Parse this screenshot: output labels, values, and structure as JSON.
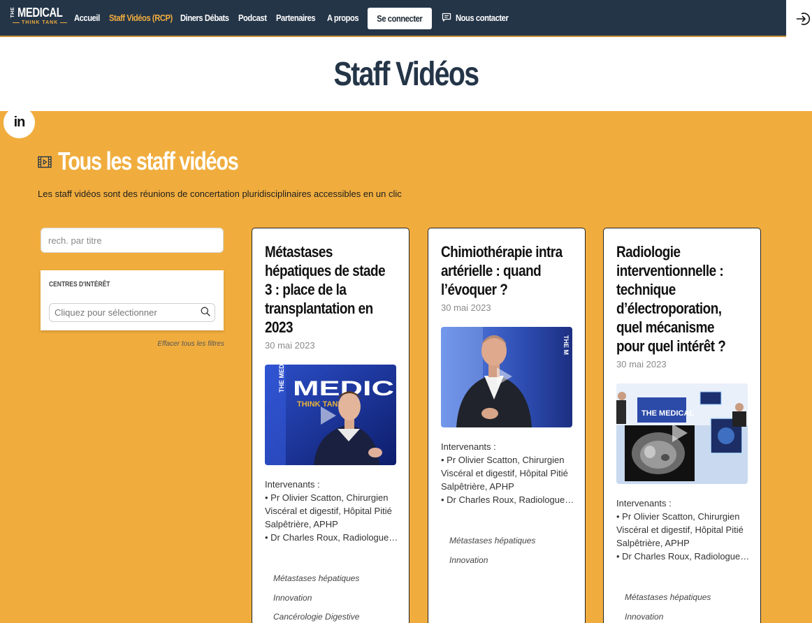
{
  "nav": {
    "logo": {
      "the": "THE",
      "medical": "MEDICAL",
      "think_tank": "THINK TANK"
    },
    "items": [
      {
        "label": "Accueil",
        "active": false
      },
      {
        "label": "Staff Vidéos (RCP)",
        "active": true
      },
      {
        "label": "Diners Débats",
        "active": false
      },
      {
        "label": "Podcast",
        "active": false
      },
      {
        "label": "Partenaires",
        "active": false
      },
      {
        "label": "A propos",
        "active": false
      }
    ],
    "connect_label": "Se connecter",
    "contact_label": "Nous contacter"
  },
  "page_title": "Staff Vidéos",
  "linkedin_label": "in",
  "section": {
    "title": "Tous les staff vidéos",
    "description": "Les staff vidéos sont des réunions de concertation pluridisciplinaires accessibles en un clic"
  },
  "filters": {
    "search_placeholder": "rech. par titre",
    "interests_label": "CENTRES D'INTÉRÊT",
    "interests_placeholder": "Cliquez pour sélectionner",
    "clear_label": "Effacer tous les filtres"
  },
  "cards": [
    {
      "title": "Métastases hépatiques de stade 3 : place de la transplantation en 2023",
      "date": "30 mai 2023",
      "thumb_text": "THE MEDICAL",
      "thumb_sub": "THINK TANK",
      "speakers": [
        "Intervenants :",
        "• Pr Olivier Scatton, Chirurgien Viscéral et digestif, Hôpital Pitié Salpêtrière, APHP",
        "• Dr Charles Roux, Radiologue…"
      ],
      "tags": [
        "Métastases hépatiques",
        "Innovation",
        "Cancérologie Digestive"
      ]
    },
    {
      "title": "Chimiothérapie intra artérielle : quand l’évoquer ?",
      "date": "30 mai 2023",
      "thumb_text": "THE M",
      "thumb_sub": "",
      "speakers": [
        "Intervenants :",
        "• Pr Olivier Scatton, Chirurgien Viscéral et digestif, Hôpital Pitié Salpêtrière, APHP",
        "• Dr Charles Roux, Radiologue…"
      ],
      "tags": [
        "Métastases hépatiques",
        "Innovation"
      ]
    },
    {
      "title": "Radiologie interventionnelle : technique d’électroporation, quel mécanisme pour quel intérêt ?",
      "date": "30 mai 2023",
      "thumb_text": "THE MEDICAL",
      "thumb_sub": "",
      "speakers": [
        "Intervenants :",
        "• Pr Olivier Scatton, Chirurgien Viscéral et digestif, Hôpital Pitié Salpêtrière, APHP",
        "• Dr Charles Roux, Radiologue…"
      ],
      "tags": [
        "Métastases hépatiques",
        "Innovation"
      ]
    }
  ],
  "colors": {
    "navy": "#243548",
    "accent": "#f0ad3e",
    "white": "#ffffff"
  }
}
